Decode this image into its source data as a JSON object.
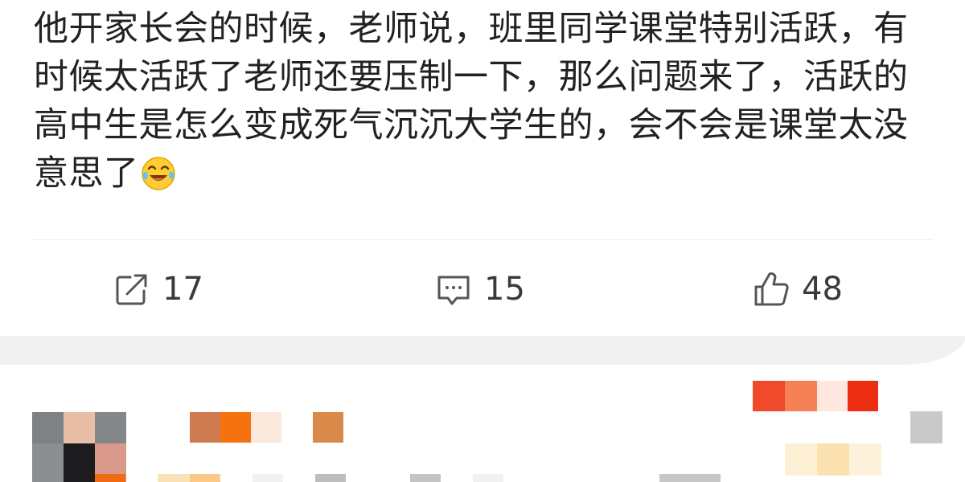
{
  "post": {
    "text": "他开家长会的时候，老师说，班里同学课堂特别活跃，有时候太活跃了老师还要压制一下，那么问题来了，活跃的高中生是怎么变成死气沉沉大学生的，会不会是课堂太没意思了",
    "emoji": "laughing-tears-emoji"
  },
  "actions": {
    "repost": {
      "icon": "share-icon",
      "count": "17"
    },
    "comment": {
      "icon": "comment-icon",
      "count": "15"
    },
    "like": {
      "icon": "thumbs-up-icon",
      "count": "48"
    }
  },
  "colors": {
    "text": "#222222",
    "count_text": "#3a3a3a",
    "icon_stroke": "#555555",
    "divider": "#ececec",
    "section_gap": "#f1f1f1"
  }
}
